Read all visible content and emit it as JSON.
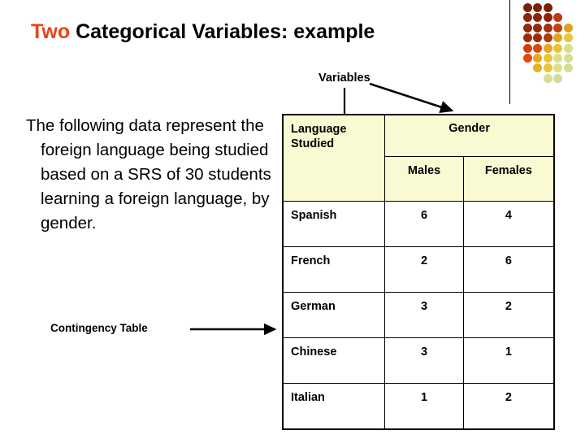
{
  "slide": {
    "title": {
      "accent_word": "Two",
      "rest": " Categorical Variables: example",
      "accent_color": "#E8431A",
      "text_color": "#000000"
    },
    "body_paragraph": "The following data represent the foreign language being studied based on a SRS of 30 students learning a foreign language, by gender.",
    "annotations": {
      "variables_label": "Variables",
      "contingency_label": "Contingency Table"
    },
    "decor": {
      "dot_grid_name": "dot-grid-decoration",
      "divider_color": "#000000"
    }
  },
  "table": {
    "header_background": "#FAFAD2",
    "border_color": "#000000",
    "row_header_label": "Language Studied",
    "row_header_line1": "Language",
    "row_header_line2": "Studied",
    "group_header": "Gender",
    "sub_headers": [
      "Males",
      "Females"
    ],
    "rows": [
      {
        "language": "Spanish",
        "males": "6",
        "females": "4"
      },
      {
        "language": "French",
        "males": "2",
        "females": "6"
      },
      {
        "language": "German",
        "males": "3",
        "females": "2"
      },
      {
        "language": "Chinese",
        "males": "3",
        "females": "1"
      },
      {
        "language": "Italian",
        "males": "1",
        "females": "2"
      }
    ]
  },
  "chart_data": {
    "type": "table",
    "title": "Two Categorical Variables: example",
    "xlabel": "Gender",
    "ylabel": "Language Studied",
    "categories": [
      "Spanish",
      "French",
      "German",
      "Chinese",
      "Italian"
    ],
    "series": [
      {
        "name": "Males",
        "values": [
          6,
          2,
          3,
          3,
          1
        ]
      },
      {
        "name": "Females",
        "values": [
          4,
          6,
          2,
          1,
          2
        ]
      }
    ],
    "total": 30,
    "annotations": [
      "Variables",
      "Contingency Table"
    ]
  }
}
